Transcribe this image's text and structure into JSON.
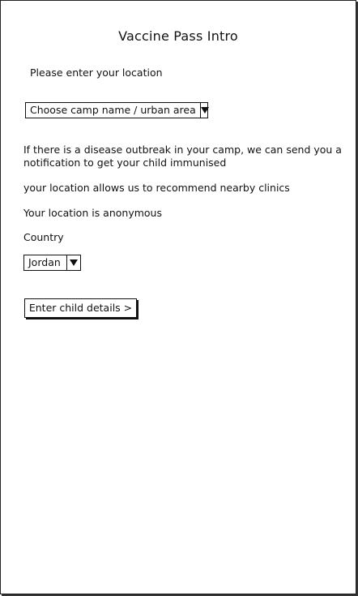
{
  "screen": {
    "title": "Vaccine Pass Intro"
  },
  "location": {
    "prompt": "Please enter your location",
    "camp_select": {
      "selected": "Choose camp name / urban area"
    }
  },
  "info": {
    "outbreak_line1": "If there is a disease outbreak in your camp, we can send you a",
    "outbreak_line2": "notification to get your child immunised",
    "clinics": "your location allows us to recommend nearby clinics",
    "anonymous": "Your location is anonymous"
  },
  "country": {
    "label": "Country",
    "select": {
      "selected": "Jordan"
    }
  },
  "actions": {
    "next_label": "Enter child details >"
  },
  "icons": {
    "dropdown": "chevron-down-icon"
  }
}
